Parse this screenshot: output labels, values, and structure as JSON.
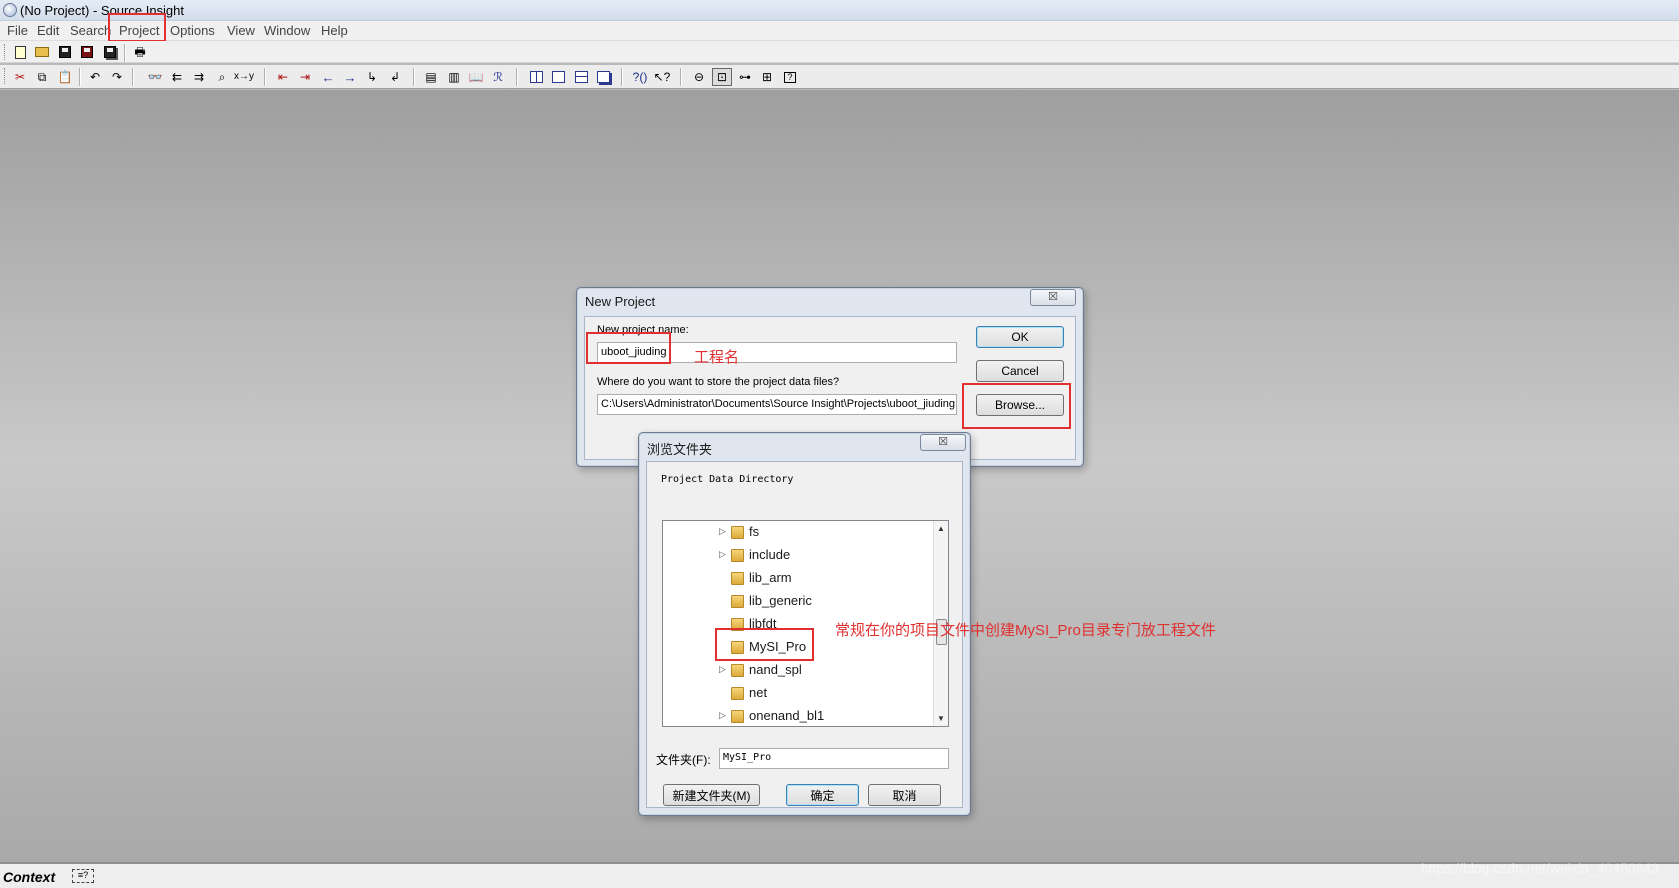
{
  "window": {
    "title": "(No Project) - Source Insight"
  },
  "menu": [
    "File",
    "Edit",
    "Search",
    "Project",
    "Options",
    "View",
    "Window",
    "Help"
  ],
  "toolbar1": {
    "icons": [
      "new-file-icon",
      "open-file-icon",
      "save-icon",
      "save-as-icon",
      "save-all-icon",
      "print-icon"
    ]
  },
  "toolbar2": {
    "icons": [
      "cut-icon",
      "copy-icon",
      "paste-icon",
      "undo-icon",
      "redo-icon",
      "search-icon",
      "search-backward-icon",
      "search-forward-icon",
      "search-files-icon",
      "replace-icon",
      "bookmark-icon",
      "bookmark-2-icon",
      "go-back-icon",
      "go-forward-icon",
      "jump-icon",
      "jump-2-icon",
      "symbol-window-icon",
      "project-window-icon",
      "browse-icon",
      "relation-icon",
      "layout-1-icon",
      "layout-2-icon",
      "layout-3-icon",
      "layout-4-icon",
      "lookup-icon",
      "context-help-icon",
      "sync-icon",
      "context-window-icon",
      "relation-window-icon",
      "clip-window-icon",
      "help-icon"
    ]
  },
  "new_project": {
    "title": "New Project",
    "close_label": "☒",
    "name_label": "New project name:",
    "name_value": "uboot_jiuding",
    "path_label": "Where do you want to store the project data files?",
    "path_value": "C:\\Users\\Administrator\\Documents\\Source Insight\\Projects\\uboot_jiuding",
    "ok_label": "OK",
    "cancel_label": "Cancel",
    "browse_label": "Browse..."
  },
  "browse_folder": {
    "title": "浏览文件夹",
    "close_label": "☒",
    "description": "Project Data Directory",
    "tree_items": [
      {
        "name": "fs",
        "expandable": true
      },
      {
        "name": "include",
        "expandable": true
      },
      {
        "name": "lib_arm",
        "expandable": false
      },
      {
        "name": "lib_generic",
        "expandable": false
      },
      {
        "name": "libfdt",
        "expandable": false
      },
      {
        "name": "MySI_Pro",
        "expandable": false,
        "selected": true
      },
      {
        "name": "nand_spl",
        "expandable": true
      },
      {
        "name": "net",
        "expandable": false
      },
      {
        "name": "onenand_bl1",
        "expandable": true
      }
    ],
    "folder_label": "文件夹(F):",
    "folder_value": "MySI_Pro",
    "new_folder_label": "新建文件夹(M)",
    "ok_label": "确定",
    "cancel_label": "取消"
  },
  "annotations": {
    "project_name_note": "工程名",
    "folder_note": "常规在你的项目文件中创建MySI_Pro目录专门放工程文件"
  },
  "status": {
    "label": "Context"
  },
  "watermark": "https://blog.csdn.net/weixin_40450943"
}
